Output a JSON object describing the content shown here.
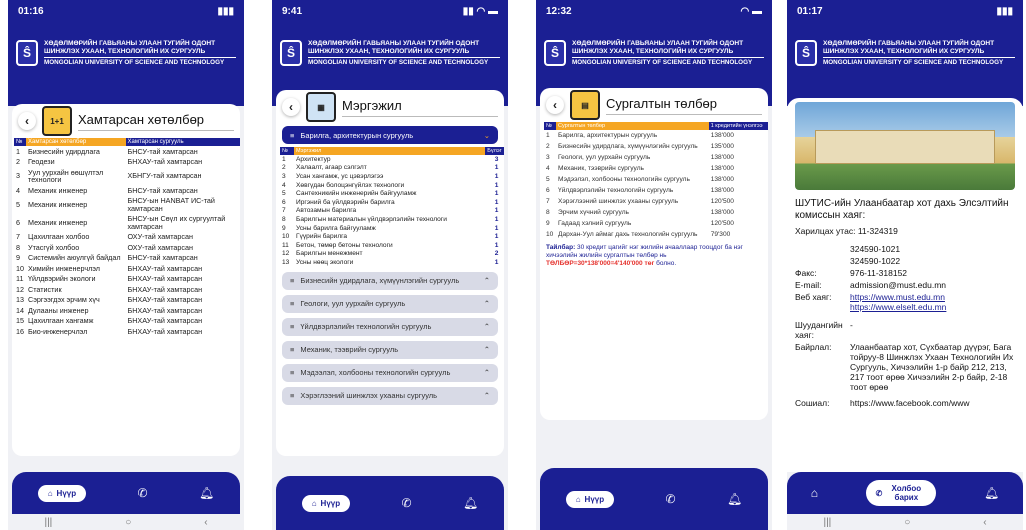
{
  "university": {
    "name_mn": "ХӨДӨЛМӨРИЙН ГАВЬЯАНЫ УЛААН ТУГИЙН ОДОНТ ШИНЖЛЭХ УХААН, ТЕХНОЛОГИЙН ИХ СУРГУУЛЬ",
    "name_en": "MONGOLIAN UNIVERSITY OF SCIENCE AND TECHNOLOGY"
  },
  "screen1": {
    "time": "01:16",
    "title": "Хамтарсан хөтөлбөр",
    "icon_text": "1+1",
    "headers": [
      "№",
      "Хамтарсан хөтөлбөр",
      "Хамтарсан сургууль"
    ],
    "rows": [
      [
        "1",
        "Бизнесийн удирдлага",
        "БНСУ-тай хамтарсан"
      ],
      [
        "2",
        "Геодези",
        "БНХАУ-тай хамтарсан"
      ],
      [
        "3",
        "Уул уурхайн өөшүлтэл технологи",
        "ХБНГУ-тай хамтарсан"
      ],
      [
        "4",
        "Механик инженер",
        "БНСУ-тай хамтарсан"
      ],
      [
        "5",
        "Механик инженер",
        "БНСУ-ын HANBAT ИС-тай хамтарсан"
      ],
      [
        "6",
        "Механик инженер",
        "БНСУ-ын Сөүл их сургуултай хамтарсан"
      ],
      [
        "7",
        "Цахилгаан холбоо",
        "ОХУ-тай хамтарсан"
      ],
      [
        "8",
        "Утасгүй холбоо",
        "ОХУ-тай хамтарсан"
      ],
      [
        "9",
        "Системийн аюулгүй байдал",
        "БНСУ-тай хамтарсан"
      ],
      [
        "10",
        "Химийн инженерчлэл",
        "БНХАУ-тай хамтарсан"
      ],
      [
        "11",
        "Үйлдвэрийн экологи",
        "БНХАУ-тай хамтарсан"
      ],
      [
        "12",
        "Статистик",
        "БНХАУ-тай хамтарсан"
      ],
      [
        "13",
        "Сэргээгдэх эрчим хүч",
        "БНХАУ-тай хамтарсан"
      ],
      [
        "14",
        "Дулааны инженер",
        "БНХАУ-тай хамтарсан"
      ],
      [
        "15",
        "Цахилгаан хангамж",
        "БНХАУ-тай хамтарсан"
      ],
      [
        "16",
        "Био-инженерчлэл",
        "БНХАУ-тай хамтарсан"
      ]
    ]
  },
  "screen2": {
    "time": "9:41",
    "title": "Мэргэжил",
    "open_section": "Барилга, архитектурын сургууль",
    "headers": [
      "№",
      "Мэргэжил",
      "Бүлэг"
    ],
    "rows": [
      [
        "1",
        "Архитектур",
        "3"
      ],
      [
        "2",
        "Халаалт, агаар сэлгэлт",
        "1"
      ],
      [
        "3",
        "Усан хангамж, ус цэвэрлэгээ",
        "1"
      ],
      [
        "4",
        "Хөвгүдан болоцэнгүйлэх технологи",
        "1"
      ],
      [
        "5",
        "Сантехникийн инженерийн байгууламж",
        "1"
      ],
      [
        "6",
        "Иргэний ба үйлдвэрийн барилга",
        "1"
      ],
      [
        "7",
        "Автозамын барилга",
        "1"
      ],
      [
        "8",
        "Барилгын материалын үйлдвэрлэлийн технологи",
        "1"
      ],
      [
        "9",
        "Усны барилга байгууламж",
        "1"
      ],
      [
        "10",
        "Гүүрийн барилга",
        "1"
      ],
      [
        "11",
        "Бетон, төмөр бетоны технологи",
        "1"
      ],
      [
        "12",
        "Барилгын менежмент",
        "2"
      ],
      [
        "13",
        "Усны нөөц экологи",
        "1"
      ]
    ],
    "sections": [
      "Бизнесийн удирдлага, хүмүүнлэгийн сургууль",
      "Геологи, уул уурхайн сургууль",
      "Үйлдвэрлэлийн технологийн сургууль",
      "Механик, тээврийн сургууль",
      "Мэдээлэл, холбооны технологийн сургууль",
      "Хэрэглээний шинжлэх ухааны сургууль"
    ]
  },
  "screen3": {
    "time": "12:32",
    "title": "Сургалтын төлбөр",
    "headers": [
      "№",
      "Сургалтын төлбөр",
      "1 кредитийн үнэлгээ"
    ],
    "rows": [
      [
        "1",
        "Барилга, архитектурын сургууль",
        "138'000"
      ],
      [
        "2",
        "Бизнесийн удирдлага, хүмүүнлэгийн сургууль",
        "135'000"
      ],
      [
        "3",
        "Геологи, уул уурхайн сургууль",
        "138'000"
      ],
      [
        "4",
        "Механик, тээврийн сургууль",
        "138'000"
      ],
      [
        "5",
        "Мэдээлэл, холбооны технологийн сургууль",
        "138'000"
      ],
      [
        "6",
        "Үйлдвэрлэлийн технологийн сургууль",
        "138'000"
      ],
      [
        "7",
        "Хэрэглээний шинжлэх ухааны сургууль",
        "120'500"
      ],
      [
        "8",
        "Эрчим хүчний сургууль",
        "138'000"
      ],
      [
        "9",
        "Гадаад хэлний сургууль",
        "120'500"
      ],
      [
        "10",
        "Дархан-Уул аймаг дахь технологийн сургууль",
        "79'300"
      ]
    ],
    "note_prefix": "Тайлбар:",
    "note_text": "30 кредит цагийг нэг жилийн ачааллаар тооцдог ба нэг хичээлийн жилийн сургалтын төлбөр нь",
    "note_formula": "ТӨЛБӨР=30*138'000=4'140'000 төг",
    "note_suffix": "болно."
  },
  "screen4": {
    "time": "01:17",
    "heading": "ШУТИС-ийн Улаанбаатар хот дахь Элсэлтийн комиссын хаяг:",
    "phone_label": "Харилцах утас:",
    "phone_value": "11-324319",
    "phone_extra1": "324590-1021",
    "phone_extra2": "324590-1022",
    "fax_label": "Факс:",
    "fax_value": "976-11-318152",
    "email_label": "E-mail:",
    "email_value": "admission@must.edu.mn",
    "web_label": "Веб хаяг:",
    "web_value1": "https://www.must.edu.mn",
    "web_value2": "https://www.elselt.edu.mn",
    "mail_label": "Шуудангийн хаяг:",
    "mail_value": "-",
    "addr_label": "Байрлал:",
    "addr_value": "Улаанбаатар хот, Сүхбаатар дүүрэг, Бага тойруу-8 Шинжлэх Ухаан Технологийн Их Сургууль, Хичээлийн 1-р байр 212, 213, 217 тоот өрөө Хичээлийн 2-р байр, 2-18 тоот өрөө",
    "social_label": "Сошиал:",
    "social_value": "https://www.facebook.com/www"
  },
  "nav": {
    "home": "Нүүр",
    "contact": "Холбоо барих"
  }
}
